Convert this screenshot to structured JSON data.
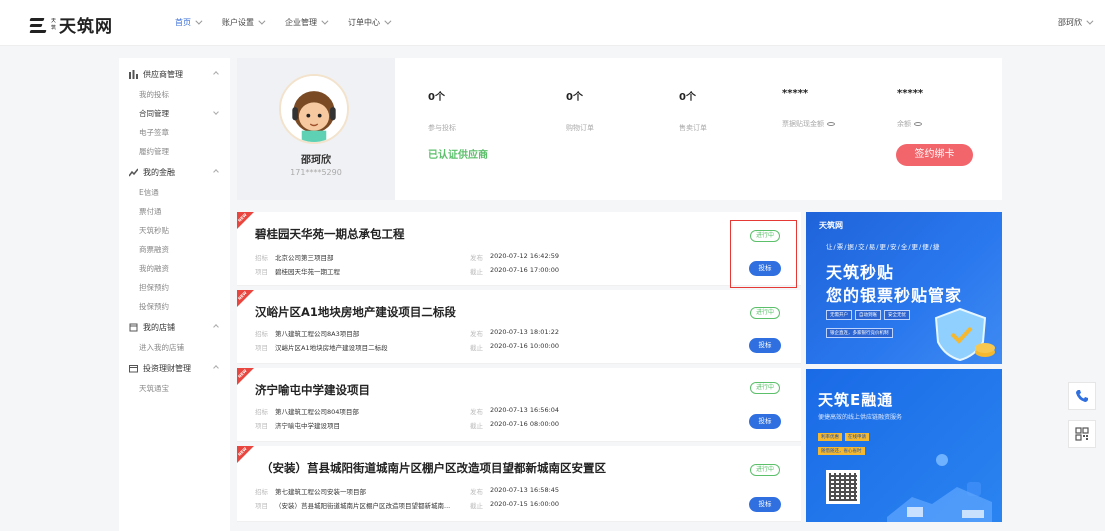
{
  "header": {
    "logo_sub": [
      "天",
      "筑"
    ],
    "logo_text": "天筑网",
    "nav": [
      {
        "label": "首页",
        "active": true
      },
      {
        "label": "账户设置",
        "active": false
      },
      {
        "label": "企业管理",
        "active": false
      },
      {
        "label": "订单中心",
        "active": false
      }
    ],
    "user": "邵珂欣"
  },
  "sidebar": {
    "groups": [
      {
        "label": "供应商管理",
        "icon": "bar-chart-icon",
        "items": [
          {
            "label": "我的投标"
          },
          {
            "label": "合同管理"
          },
          {
            "label": "电子签章"
          },
          {
            "label": "履约管理"
          }
        ]
      },
      {
        "label": "我的金融",
        "icon": "finance-icon",
        "items": [
          {
            "label": "E信通"
          },
          {
            "label": "票付通"
          },
          {
            "label": "天筑秒贴"
          },
          {
            "label": "商票融资"
          },
          {
            "label": "我的融资"
          },
          {
            "label": "担保预约"
          },
          {
            "label": "投保预约"
          }
        ]
      },
      {
        "label": "我的店铺",
        "icon": "shop-icon",
        "items": [
          {
            "label": "进入我的店铺"
          }
        ]
      },
      {
        "label": "投资理财管理",
        "icon": "wallet-icon",
        "items": [
          {
            "label": "天筑通宝"
          }
        ]
      }
    ]
  },
  "profile": {
    "name": "邵珂欣",
    "phone": "171****5290",
    "verified": "已认证供应商",
    "sign_button": "签约绑卡",
    "stats": [
      {
        "value": "0个",
        "label": "参与投标"
      },
      {
        "value": "0个",
        "label": "购物订单"
      },
      {
        "value": "0个",
        "label": "售卖订单"
      },
      {
        "value": "*****",
        "label": "票据贴现金额"
      },
      {
        "value": "*****",
        "label": "余额"
      }
    ]
  },
  "projects": [
    {
      "title": "碧桂园天华苑一期总承包工程",
      "bidder_key": "招标",
      "bidder": "北京公司第三项目部",
      "project_key": "项目",
      "project": "碧桂园天华苑一期工程",
      "publish_key": "发布",
      "publish": "2020-07-12 16:42:59",
      "deadline_key": "截止",
      "deadline": "2020-07-16 17:00:00",
      "status": "进行中",
      "button": "投标"
    },
    {
      "title": "汉峪片区A1地块房地产建设项目二标段",
      "bidder_key": "招标",
      "bidder": "第八建筑工程公司8A3项目部",
      "project_key": "项目",
      "project": "汉峪片区A1地块房地产建设项目二标段",
      "publish_key": "发布",
      "publish": "2020-07-13 18:01:22",
      "deadline_key": "截止",
      "deadline": "2020-07-16 10:00:00",
      "status": "进行中",
      "button": "投标"
    },
    {
      "title": "济宁喻屯中学建设项目",
      "bidder_key": "招标",
      "bidder": "第八建筑工程公司804项目部",
      "project_key": "项目",
      "project": "济宁喻屯中学建设项目",
      "publish_key": "发布",
      "publish": "2020-07-13 16:56:04",
      "deadline_key": "截止",
      "deadline": "2020-07-16 08:00:00",
      "status": "进行中",
      "button": "投标"
    },
    {
      "title": "（安装）莒县城阳街道城南片区棚户区改造项目望都新城南区安置区",
      "bidder_key": "招标",
      "bidder": "第七建筑工程公司安装一项目部",
      "project_key": "项目",
      "project": "（安装）莒县城阳街道城南片区棚户区改造项目望都新城南...",
      "publish_key": "发布",
      "publish": "2020-07-13 16:58:45",
      "deadline_key": "截止",
      "deadline": "2020-07-15 16:00:00",
      "status": "进行中",
      "button": "投标"
    }
  ],
  "ribbon_text": "NEW",
  "banner1": {
    "logo": "天筑网",
    "tagline": "让/票/据/交/易/更/安/全/更/便/捷",
    "title1": "天筑秒贴",
    "title2": "您的银票秒贴管家",
    "chips": [
      "无需开户",
      "自动到账",
      "安全无忧"
    ],
    "chip2": "银企直连，多家银行竞价机制"
  },
  "banner2": {
    "title": "天筑E融通",
    "subtitle": "便捷高效的线上供应链融资服务",
    "chips": [
      "利率优惠",
      "在线申请"
    ],
    "chip2": "随借随还，省心省时"
  },
  "colors": {
    "accent": "#2f6fe0",
    "status_green": "#5cc06b",
    "sign_red": "#f2656b",
    "highlight_red": "#e53935"
  }
}
